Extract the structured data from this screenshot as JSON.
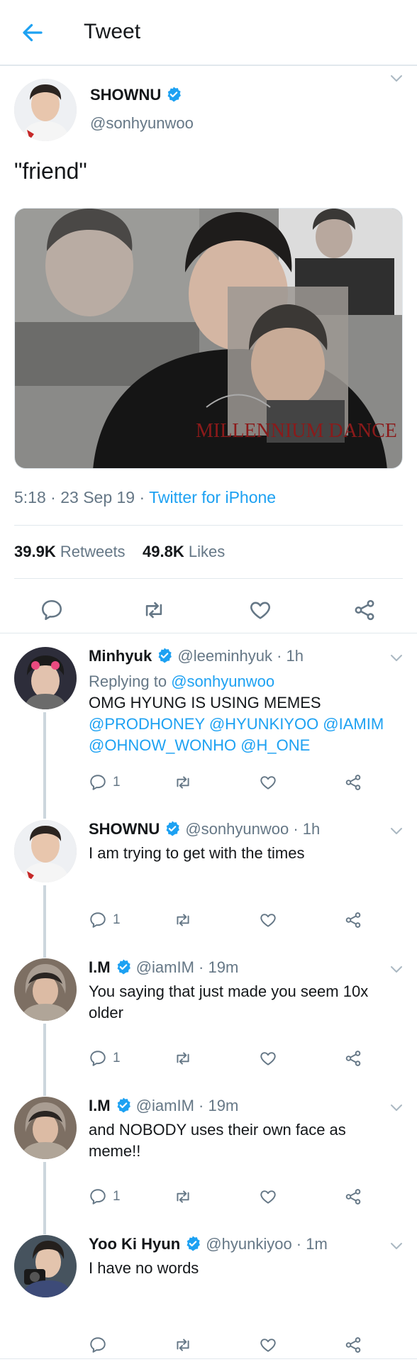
{
  "header": {
    "title": "Tweet"
  },
  "main_tweet": {
    "author_name": "SHOWNU",
    "author_handle": "@sonhyunwoo",
    "text": "\"friend\"",
    "media_text": "MILLENNIUM DANCE COMPLEX",
    "time": "5:18",
    "date": "23 Sep 19",
    "source": "Twitter for iPhone",
    "retweets_count": "39.9K",
    "retweets_label": "Retweets",
    "likes_count": "49.8K",
    "likes_label": "Likes"
  },
  "replies": [
    {
      "name": "Minhyuk",
      "handle": "@leeminhyuk",
      "time": "1h",
      "replying_prefix": "Replying to",
      "replying_to": "@sonhyunwoo",
      "text": "OMG HYUNG IS USING MEMES",
      "mentions_line1": "@PRODHONEY @HYUNKIYOO @IAMIM",
      "mentions_line2": "@OHNOW_WONHO @H_ONE",
      "reply_count": "1"
    },
    {
      "name": "SHOWNU",
      "handle": "@sonhyunwoo",
      "time": "1h",
      "text": "I am trying to get with the times",
      "reply_count": "1"
    },
    {
      "name": "I.M",
      "handle": "@iamIM",
      "time": "19m",
      "text_line1": "You saying that just made you seem 10x",
      "text_line2": "older",
      "reply_count": "1"
    },
    {
      "name": "I.M",
      "handle": "@iamIM",
      "time": "19m",
      "text_line1": "and NOBODY uses their own face as",
      "text_line2": "meme!!",
      "reply_count": "1"
    },
    {
      "name": "Yoo Ki Hyun",
      "handle": "@hyunkiyoo",
      "time": "1m",
      "text": "I have no words",
      "reply_count": ""
    }
  ],
  "icons": {
    "back": "arrow-left-icon",
    "verified": "verified-badge-icon",
    "reply": "speech-bubble-icon",
    "retweet": "retweet-icon",
    "like": "heart-icon",
    "share": "share-icon"
  },
  "colors": {
    "accent": "#1da1f2",
    "text": "#14171a",
    "secondary": "#657786",
    "divider": "#e1e8ed",
    "thread_line": "#ccd6dd"
  }
}
